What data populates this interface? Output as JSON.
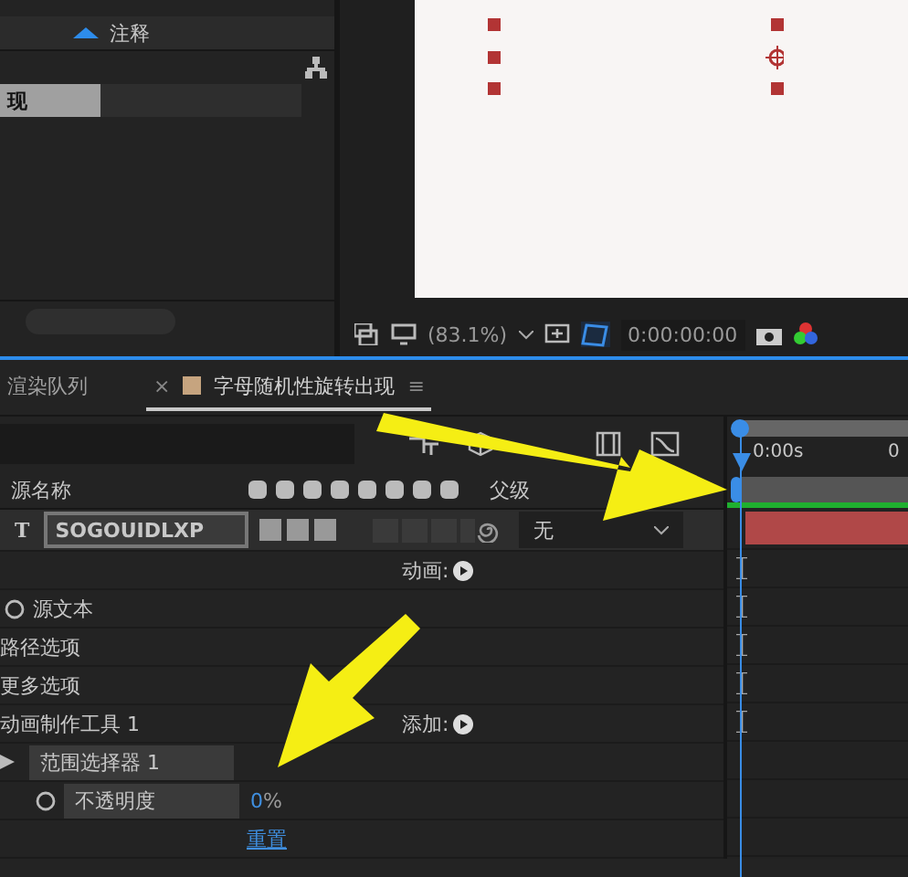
{
  "project_panel": {
    "column_header": "注释",
    "selected_item": "现"
  },
  "viewer": {
    "zoom": "(83.1%)",
    "timecode": "0:00:00:00"
  },
  "tabs": [
    {
      "label": "渲染队列",
      "selected": false
    },
    {
      "label": "字母随机性旋转出现",
      "selected": true,
      "close": "×",
      "menu": "≡"
    }
  ],
  "columns": {
    "name": "源名称",
    "parent": "父级"
  },
  "layer": {
    "type_glyph": "T",
    "name": "SOGOUIDLXP",
    "parent": "无"
  },
  "properties": [
    {
      "kind": "plain",
      "action": "动画:",
      "marker": true
    },
    {
      "kind": "stopwatch",
      "label": "源文本",
      "marker": true
    },
    {
      "kind": "plain",
      "label": "路径选项",
      "marker": true
    },
    {
      "kind": "plain",
      "label": "更多选项",
      "marker": true
    },
    {
      "kind": "plain",
      "label": "动画制作工具 1",
      "action": "添加:",
      "marker": true
    },
    {
      "kind": "selector",
      "label": "范围选择器 1",
      "marker": false
    },
    {
      "kind": "property",
      "label": "不透明度",
      "value": "0",
      "unit": "%",
      "marker": false
    },
    {
      "kind": "plain",
      "link": "重置",
      "marker": false
    }
  ],
  "timeline": {
    "start_label": "0:00s",
    "next_label": "0"
  }
}
